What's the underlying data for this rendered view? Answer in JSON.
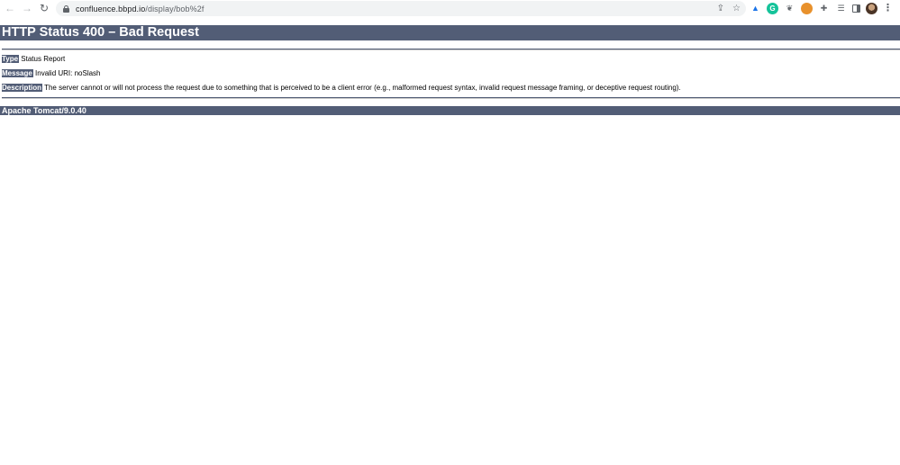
{
  "browser": {
    "back_icon": "←",
    "forward_icon": "→",
    "reload_icon": "↻",
    "url_host": "confluence.bbpd.io",
    "url_path": "/display/bob%2f",
    "share_icon": "⇪",
    "bookmark_icon": "☆",
    "extensions": {
      "drive": "▲",
      "grammarly": "G",
      "bird": "❦",
      "cookie": "●",
      "puzzle": "✚",
      "reading_list": "☰",
      "menu": "⋮"
    }
  },
  "page": {
    "title": "HTTP Status 400 – Bad Request",
    "type_label": "Type",
    "type_value": " Status Report",
    "message_label": "Message",
    "message_value": " Invalid URI: noSlash",
    "description_label": "Description",
    "description_value": " The server cannot or will not process the request due to something that is perceived to be a client error (e.g., malformed request syntax, invalid request message framing, or deceptive request routing).",
    "footer": "Apache Tomcat/9.0.40"
  },
  "colors": {
    "header_bg": "#525d76",
    "text_on_header": "#ffffff"
  }
}
